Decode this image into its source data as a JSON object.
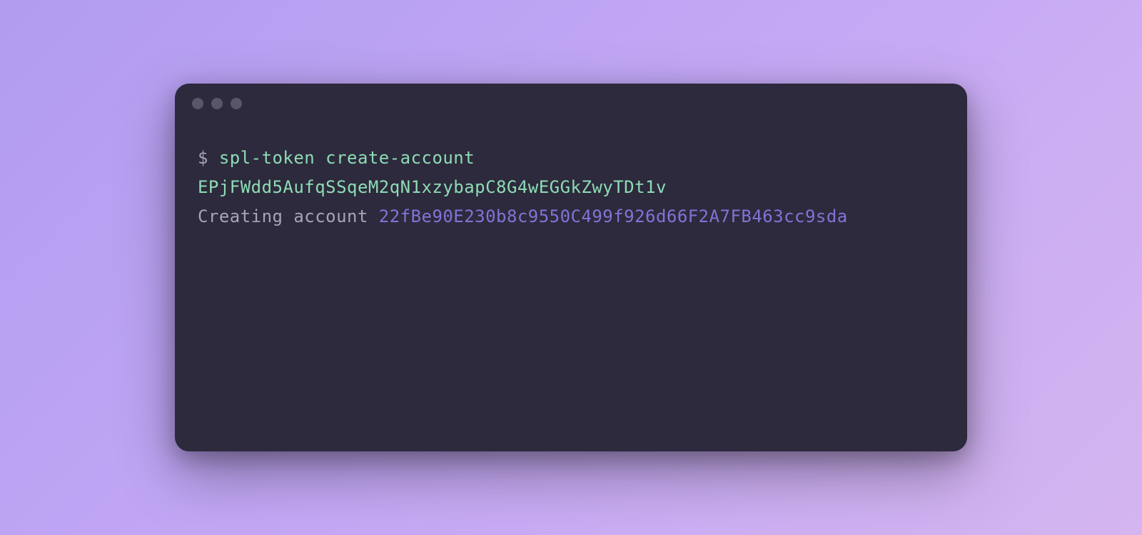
{
  "terminal": {
    "prompt": "$ ",
    "command": "spl-token create-account",
    "arg": "EPjFWdd5AufqSSqeM2qN1xzybapC8G4wEGGkZwyTDt1v",
    "output_label": "Creating account ",
    "output_value": "22fBe90E230b8c9550C499f926d66F2A7FB463cc9sda"
  }
}
